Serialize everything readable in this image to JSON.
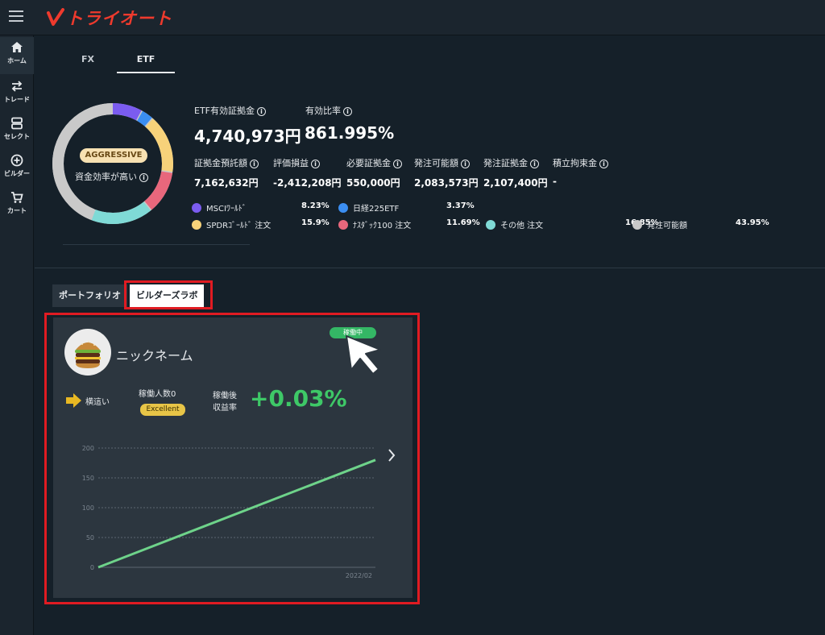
{
  "app": {
    "brand": "トライオート",
    "brand_color": "#ee3a2d"
  },
  "sidebar": {
    "items": [
      {
        "icon": "home-icon",
        "label": "ホーム"
      },
      {
        "icon": "trade-icon",
        "label": "トレード"
      },
      {
        "icon": "select-icon",
        "label": "セレクト"
      },
      {
        "icon": "builder-icon",
        "label": "ビルダー"
      },
      {
        "icon": "cart-icon",
        "label": "カート"
      }
    ]
  },
  "asset_tabs": [
    {
      "label": "FX"
    },
    {
      "label": "ETF",
      "active": true
    }
  ],
  "donut": {
    "badge": "AGGRESSIVE",
    "caption": "資金効率が高い",
    "segments": [
      {
        "name": "MSCIﾜｰﾙﾄﾞ",
        "percent": 8.23,
        "color": "#7b5cf0"
      },
      {
        "name": "日経225ETF",
        "percent": 3.37,
        "color": "#3b8ef2"
      },
      {
        "name": "SPDRｺﾞｰﾙﾄﾞ",
        "percent": 15.9,
        "color": "#f7d27a"
      },
      {
        "name": "ﾅｽﾀﾞｯｸ100",
        "percent": 11.69,
        "color": "#e8677c"
      },
      {
        "name": "その他",
        "percent": 16.85,
        "color": "#7fdad6"
      },
      {
        "name": "発注可能額",
        "percent": 43.95,
        "color": "#c9c9c9"
      }
    ]
  },
  "summary": {
    "margin_label": "ETF有効証拠金",
    "margin_value": "4,740,973円",
    "ratio_label": "有効比率",
    "ratio_value": "861.995%",
    "details": [
      {
        "label": "証拠金預託額",
        "value": "7,162,632円"
      },
      {
        "label": "評価損益",
        "value": "-2,412,208円"
      },
      {
        "label": "必要証拠金",
        "value": "550,000円"
      },
      {
        "label": "発注可能額",
        "value": "2,083,573円"
      },
      {
        "label": "発注証拠金",
        "value": "2,107,400円"
      },
      {
        "label": "積立拘束金",
        "value": "-"
      }
    ]
  },
  "legend": [
    {
      "name": "MSCIﾜｰﾙﾄﾞ",
      "value": "8.23%",
      "color": "#7b5cf0"
    },
    {
      "name": "日経225ETF",
      "value": "3.37%",
      "color": "#3b8ef2"
    },
    {
      "name": "SPDRｺﾞｰﾙﾄﾞ 注文",
      "value": "15.9%",
      "color": "#f7d27a"
    },
    {
      "name": "ﾅｽﾀﾞｯｸ100 注文",
      "value": "11.69%",
      "color": "#e8677c"
    },
    {
      "name": "その他 注文",
      "value": "16.85%",
      "color": "#7fdad6"
    },
    {
      "name": "発注可能額",
      "value": "43.95%",
      "color": "#c9c9c9"
    }
  ],
  "content_tabs": {
    "portfolio": "ポートフォリオ",
    "builder": "ビルダーズラボ"
  },
  "card": {
    "nickname": "ニックネーム",
    "status": "稼働中",
    "trend": "横這い",
    "operators": "稼働人数0",
    "rating": "Excellent",
    "return_label_1": "稼働後",
    "return_label_2": "収益率",
    "return_value": "+0.03%",
    "accent": "#3ec867"
  },
  "chart_data": {
    "type": "line",
    "y_ticks": [
      "0",
      "50",
      "100",
      "150",
      "200"
    ],
    "ylim": [
      0,
      200
    ],
    "x_label_end": "2022/02",
    "series": [
      {
        "x": [
          0,
          1
        ],
        "values": [
          0,
          180
        ]
      }
    ],
    "grid": true
  }
}
